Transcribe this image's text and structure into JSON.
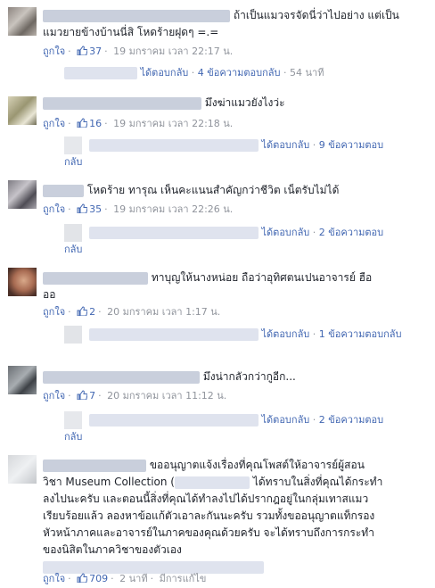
{
  "comments": [
    {
      "text_line1": "ถ้าเป็นแมวจรจัดนี่ว่าไปอย่าง แต่เป็น",
      "text_line2": "แมวยายข้างบ้านนี่สิ โหดร้ายฝุดๆ =.=",
      "like_label": "ถูกใจ",
      "like_count": "37",
      "timestamp": "19 มกราคม เวลา 22:17 น.",
      "reply_author_label": "ได้ตอบกลับ",
      "reply_count_label": "4 ข้อความตอบกลับ",
      "reply_time": "54 นาที"
    },
    {
      "text_line1": "มึงฆ่าแมวยังไงว่ะ",
      "like_label": "ถูกใจ",
      "like_count": "16",
      "timestamp": "19 มกราคม เวลา 22:18 น.",
      "reply_author_label": "ได้ตอบกลับ",
      "reply_count_label": "9 ข้อความตอบ",
      "reply_wrap": "กลับ"
    },
    {
      "text_line1": "โหดร้าย ทารุณ เห็นคะแนนสำคัญกว่าชีวิต เน็ตรับไม่ได้",
      "like_label": "ถูกใจ",
      "like_count": "35",
      "timestamp": "19 มกราคม เวลา 22:26 น.",
      "reply_author_label": "ได้ตอบกลับ",
      "reply_count_label": "2 ข้อความตอบ",
      "reply_wrap": "กลับ"
    },
    {
      "text_line1": "ทาบุญให้นางหน่อย ถือว่าอุทิศตนเปนอาจารย์ ฮือ",
      "text_line2": "ออ",
      "like_label": "ถูกใจ",
      "like_count": "2",
      "timestamp": "20 มกราคม เวลา 1:17 น.",
      "reply_author_label": "ได้ตอบกลับ",
      "reply_count_label": "1 ข้อความตอบกลับ"
    },
    {
      "text_line1": "มึงน่ากลัวกว่ากูอีก...",
      "like_label": "ถูกใจ",
      "like_count": "7",
      "timestamp": "20 มกราคม เวลา 11:12 น.",
      "reply_author_label": "ได้ตอบกลับ",
      "reply_count_label": "2 ข้อความตอบ",
      "reply_wrap": "กลับ"
    },
    {
      "text_line1": "ขออนุญาตแจ้งเรื่องที่คุณโพสต์ให้อาจารย์ผู้สอน",
      "text_line2a": "วิชา Museum Collection (",
      "text_line2b": "ได้ทราบในสิ่งที่คุณได้กระทำ",
      "text_line3": "ลงไปนะครับ และตอนนี้สิ่งที่คุณได้ทำลงไปได้ปรากฎอยู่ในกลุ่มเทาสแมว",
      "text_line4": "เรียบร้อยแล้ว ลองหาข้อแก้ตัวเอาละกันนะครับ รวมทั้งขออนุญาตแท็กรอง",
      "text_line5": "หัวหน้าภาคและอาจารย์ในภาคของคุณด้วยครับ จะได้ทราบถึงการกระทำ",
      "text_line6": "ของนิสิตในภาควิชาของตัวเอง",
      "like_label": "ถูกใจ",
      "like_count": "709",
      "timestamp": "2 นาที",
      "edited_label": "มีการแก้ไข"
    }
  ],
  "colors": {
    "link": "#4267b2",
    "meta": "#90949c",
    "text": "#1d2129",
    "redacted": "#dfe3ee"
  },
  "icons": {
    "like": "thumbs-up-icon",
    "reply": "reply-arrow-icon"
  }
}
